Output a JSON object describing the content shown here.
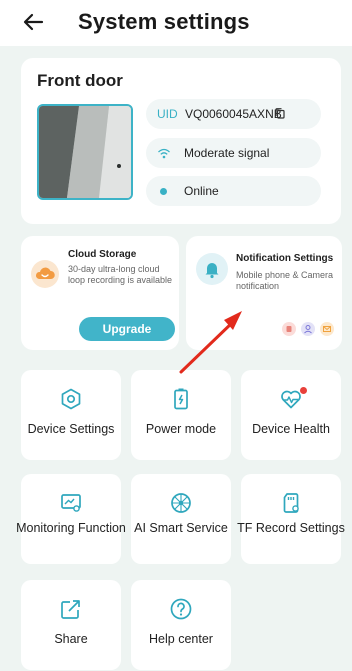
{
  "header": {
    "title": "System settings"
  },
  "device": {
    "name": "Front door",
    "uid_label": "UID",
    "uid_value": "VQ0060045AXNB",
    "signal": "Moderate signal",
    "status": "Online"
  },
  "cloud": {
    "title": "Cloud Storage",
    "description": "30-day ultra-long cloud loop recording is available",
    "button": "Upgrade"
  },
  "notification": {
    "title": "Notification Settings",
    "description": "Mobile phone & Camera notification"
  },
  "grid": [
    {
      "label": "Device Settings",
      "icon": "hexagon-gear-icon"
    },
    {
      "label": "Power mode",
      "icon": "battery-icon"
    },
    {
      "label": "Device Health",
      "icon": "heart-pulse-icon"
    },
    {
      "label": "Monitoring Function",
      "icon": "monitor-icon"
    },
    {
      "label": "AI Smart Service",
      "icon": "ai-network-icon"
    },
    {
      "label": "TF Record Settings",
      "icon": "sd-card-icon"
    },
    {
      "label": "Share",
      "icon": "share-icon"
    },
    {
      "label": "Help center",
      "icon": "help-icon"
    }
  ],
  "colors": {
    "accent": "#41b4c9",
    "background": "#eef4f2",
    "badge": "#e8403a",
    "arrow": "#e22a1c"
  }
}
